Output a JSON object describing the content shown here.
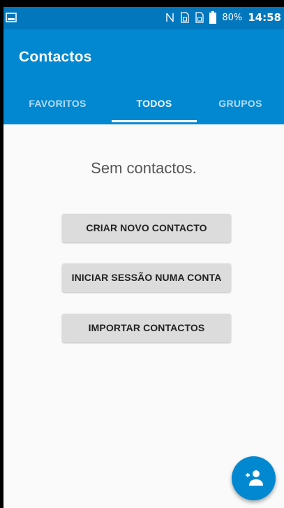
{
  "status_bar": {
    "left_icon": "image-icon",
    "icons": [
      "nfc-icon",
      "sim-icon",
      "sim-icon",
      "battery-icon"
    ],
    "battery": "80%",
    "time": "14:58"
  },
  "app_bar": {
    "title": "Contactos",
    "tabs": [
      {
        "label": "FAVORITOS",
        "active": false
      },
      {
        "label": "TODOS",
        "active": true
      },
      {
        "label": "GRUPOS",
        "active": false
      }
    ]
  },
  "main": {
    "empty_message": "Sem contactos.",
    "buttons": [
      {
        "label": "CRIAR NOVO CONTACTO"
      },
      {
        "label": "INICIAR SESSÃO NUMA CONTA"
      },
      {
        "label": "IMPORTAR CONTACTOS"
      }
    ]
  },
  "fab": {
    "icon": "add-person-icon"
  },
  "colors": {
    "status_bar": "#0277bd",
    "app_bar": "#0288d1",
    "background": "#fafafa",
    "button": "#dcdcdc"
  }
}
